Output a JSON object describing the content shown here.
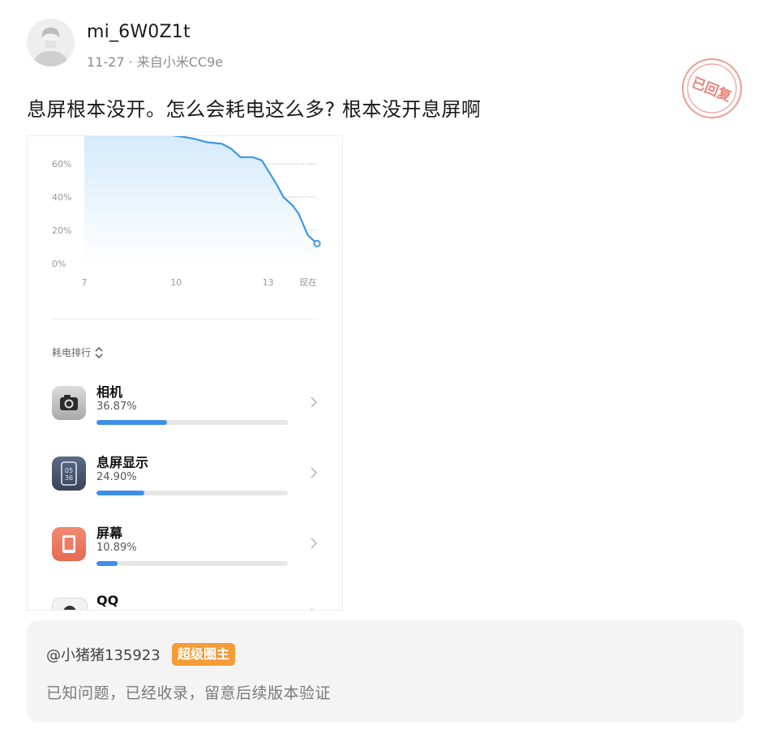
{
  "post": {
    "username": "mi_6W0Z1t",
    "meta": "11-27 · 来自小米CC9e",
    "stamp_text": "已回复",
    "content": "息屏根本没开。怎么会耗电这么多? 根本没开息屏啊"
  },
  "screenshot": {
    "chart_data": {
      "type": "area",
      "x": [
        6.4,
        7.0,
        7.5,
        8.0,
        8.5,
        9.0,
        9.5,
        9.9,
        10.3,
        10.6,
        11.0,
        11.5,
        11.8,
        12.1,
        12.5,
        12.8,
        13.0,
        13.3,
        13.5,
        13.8,
        14.0,
        14.3,
        14.6
      ],
      "y": [
        90,
        88,
        86,
        84,
        82,
        80,
        78,
        77,
        76,
        75,
        73,
        72,
        69,
        64,
        64,
        62,
        56,
        47,
        40,
        35,
        30,
        17,
        12
      ],
      "x_ticks": [
        "7",
        "10",
        "13",
        "现在"
      ],
      "y_ticks": [
        "0%",
        "20%",
        "40%",
        "60%"
      ],
      "ylim": [
        0,
        80
      ],
      "grid": true,
      "colors": {
        "line": "#3d98e0",
        "fill": "#d6ecfb"
      }
    },
    "ranking": {
      "title": "耗电排行",
      "apps": [
        {
          "name": "相机",
          "percent": "36.87%",
          "fraction": 0.3687,
          "icon": "camera-icon"
        },
        {
          "name": "息屏显示",
          "percent": "24.90%",
          "fraction": 0.249,
          "icon": "always-on-display-icon"
        },
        {
          "name": "屏幕",
          "percent": "10.89%",
          "fraction": 0.1089,
          "icon": "screen-icon"
        },
        {
          "name": "QQ",
          "percent": "",
          "fraction": 0,
          "icon": "qq-icon"
        }
      ]
    }
  },
  "reply": {
    "user": "@小猪猪135923",
    "badge": "超级圈主",
    "text": "已知问题，已经收录，留意后续版本验证"
  },
  "colors": {
    "accent": "#3d8ee6",
    "badge": "#f49c36",
    "stamp": "#e8837c"
  }
}
